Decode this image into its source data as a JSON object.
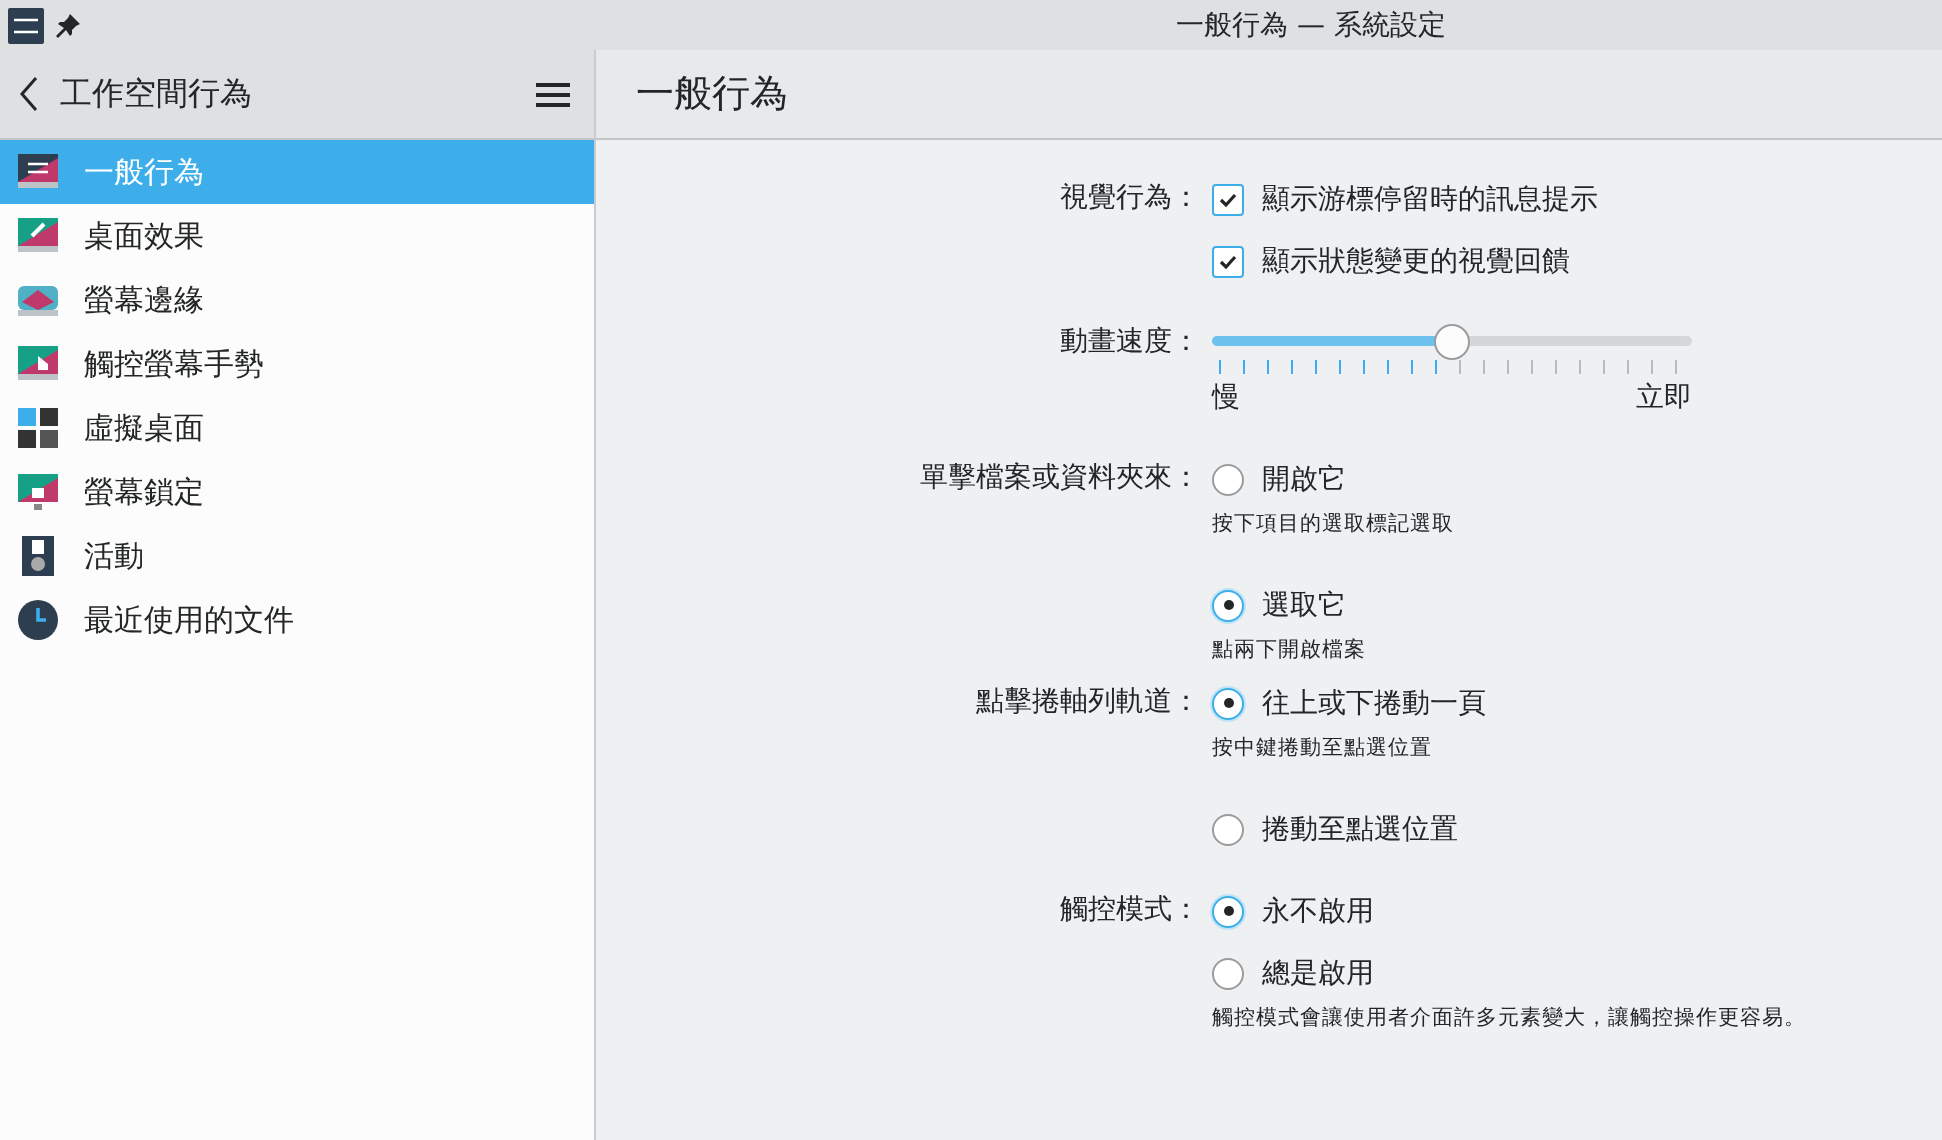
{
  "window": {
    "title": "一般行為 — 系統設定"
  },
  "sidebar": {
    "title": "工作空間行為",
    "items": [
      {
        "label": "一般行為",
        "selected": true
      },
      {
        "label": "桌面效果",
        "selected": false
      },
      {
        "label": "螢幕邊緣",
        "selected": false
      },
      {
        "label": "觸控螢幕手勢",
        "selected": false
      },
      {
        "label": "虛擬桌面",
        "selected": false
      },
      {
        "label": "螢幕鎖定",
        "selected": false
      },
      {
        "label": "活動",
        "selected": false
      },
      {
        "label": "最近使用的文件",
        "selected": false
      }
    ]
  },
  "page": {
    "title": "一般行為",
    "sections": [
      {
        "kind": "checkboxes",
        "label": "視覺行為：",
        "items": [
          {
            "text": "顯示游標停留時的訊息提示",
            "checked": true
          },
          {
            "text": "顯示狀態變更的視覺回饋",
            "checked": true
          }
        ]
      },
      {
        "kind": "slider",
        "label": "動畫速度：",
        "level": 0.5,
        "min_label": "慢",
        "max_label": "立即"
      },
      {
        "kind": "radios",
        "label": "單擊檔案或資料夾來：",
        "items": [
          {
            "text": "開啟它",
            "selected": false,
            "hint": "按下項目的選取標記選取"
          },
          {
            "text": "選取它",
            "selected": true,
            "hint": "點兩下開啟檔案"
          }
        ]
      },
      {
        "kind": "radios",
        "label": "點擊捲軸列軌道：",
        "items": [
          {
            "text": "往上或下捲動一頁",
            "selected": true,
            "hint": "按中鍵捲動至點選位置"
          },
          {
            "text": "捲動至點選位置",
            "selected": false
          }
        ]
      },
      {
        "kind": "radios",
        "label": "觸控模式：",
        "items": [
          {
            "text": "永不啟用",
            "selected": true
          },
          {
            "text": "總是啟用",
            "selected": false,
            "hint": "觸控模式會讓使用者介面許多元素變大，讓觸控操作更容易。"
          }
        ]
      }
    ]
  }
}
